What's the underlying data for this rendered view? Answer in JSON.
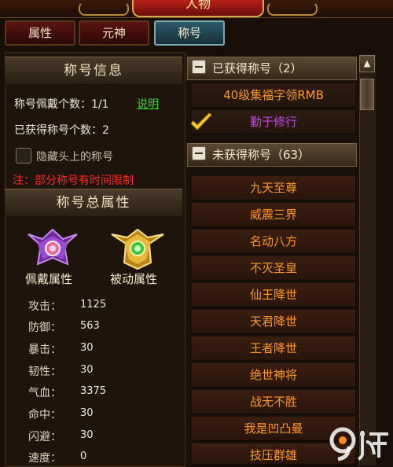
{
  "window": {
    "title": "人物"
  },
  "tabs": [
    {
      "label": "属性"
    },
    {
      "label": "元神"
    },
    {
      "label": "称号"
    }
  ],
  "title_info": {
    "heading": "称号信息",
    "equipped_count_label": "称号佩戴个数：1/1",
    "help_link": "说明",
    "obtained_count_label": "已获得称号个数：2",
    "hide_title_label": "隐藏头上的称号",
    "hide_title_checked": false,
    "note": "注：部分称号有时间限制"
  },
  "total_attributes": {
    "heading": "称号总属性",
    "equip_label": "佩戴属性",
    "passive_label": "被动属性",
    "stats": [
      {
        "label": "攻击：",
        "value": "1125"
      },
      {
        "label": "防御：",
        "value": "563"
      },
      {
        "label": "暴击：",
        "value": "30"
      },
      {
        "label": "韧性：",
        "value": "30"
      },
      {
        "label": "气血：",
        "value": "3375"
      },
      {
        "label": "命中：",
        "value": "30"
      },
      {
        "label": "闪避：",
        "value": "30"
      },
      {
        "label": "速度：",
        "value": "0"
      }
    ]
  },
  "obtained_group": {
    "label": "已获得称号（2）",
    "items": [
      {
        "name": "40级集福字领RMB",
        "color": "#ff9a2a",
        "equipped": false
      },
      {
        "name": "勤于修行",
        "color": "#c04ae0",
        "equipped": true
      }
    ]
  },
  "unobtained_group": {
    "label": "未获得称号（63）",
    "items": [
      {
        "name": "九天至尊"
      },
      {
        "name": "威震三界"
      },
      {
        "name": "名动八方"
      },
      {
        "name": "不灭圣皇"
      },
      {
        "name": "仙王降世"
      },
      {
        "name": "天君降世"
      },
      {
        "name": "王者降世"
      },
      {
        "name": "绝世神将"
      },
      {
        "name": "战无不胜"
      },
      {
        "name": "我是凹凸曼"
      },
      {
        "name": "技压群雄"
      }
    ]
  },
  "colors": {
    "accent": "#2c5a68",
    "title_orange": "#ff9a2a",
    "title_purple": "#c04ae0",
    "note_red": "#ff2a20",
    "link_green": "#2ee02e"
  }
}
